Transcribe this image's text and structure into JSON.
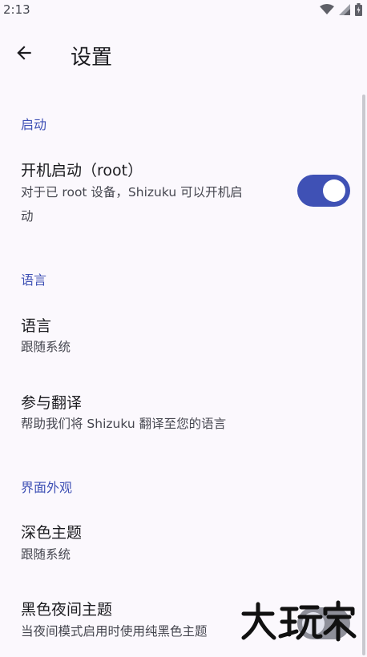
{
  "status_bar": {
    "time": "2:13",
    "icons": [
      "wifi-icon",
      "signal-icon",
      "battery-icon"
    ]
  },
  "app_bar": {
    "back_icon": "arrow-back-icon",
    "title": "设置"
  },
  "sections": {
    "startup": {
      "header": "启动",
      "boot_pref": {
        "title": "开机启动（root）",
        "summary_line1": "对于已 root 设备，Shizuku 可以开机启",
        "summary_line2": "动",
        "enabled": true
      }
    },
    "language": {
      "header": "语言",
      "language_pref": {
        "title": "语言",
        "summary": "跟随系统"
      },
      "translate_pref": {
        "title": "参与翻译",
        "summary": "帮助我们将 Shizuku 翻译至您的语言"
      }
    },
    "appearance": {
      "header": "界面外观",
      "dark_theme_pref": {
        "title": "深色主题",
        "summary": "跟随系统"
      },
      "black_night_pref": {
        "title": "黑色夜间主题",
        "summary": "当夜间模式启用时使用纯黑色主题",
        "enabled": false
      }
    }
  },
  "watermark_text": "大玩家",
  "colors": {
    "accent": "#3F51B5",
    "background": "#FBF8FD",
    "switch_off_track": "#8E8F99"
  }
}
